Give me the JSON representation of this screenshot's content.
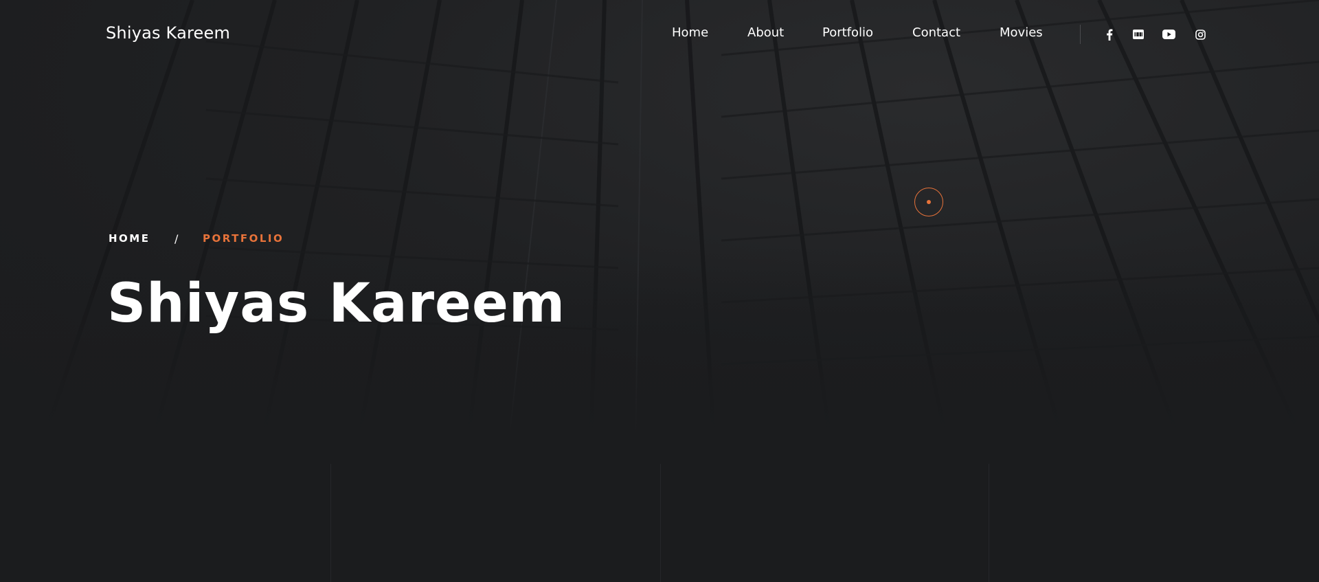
{
  "header": {
    "logo": "Shiyas Kareem",
    "nav": [
      {
        "label": "Home"
      },
      {
        "label": "About"
      },
      {
        "label": "Portfolio"
      },
      {
        "label": "Contact"
      },
      {
        "label": "Movies"
      }
    ],
    "socials": [
      {
        "icon": "facebook-icon"
      },
      {
        "icon": "imdb-icon"
      },
      {
        "icon": "youtube-icon"
      },
      {
        "icon": "instagram-icon"
      }
    ]
  },
  "hero": {
    "breadcrumb": {
      "home": "HOME",
      "separator": "/",
      "current": "PORTFOLIO"
    },
    "title": "Shiyas Kareem"
  },
  "colors": {
    "accent": "#e8733a",
    "background": "#1b1c1e",
    "text": "#ffffff"
  }
}
